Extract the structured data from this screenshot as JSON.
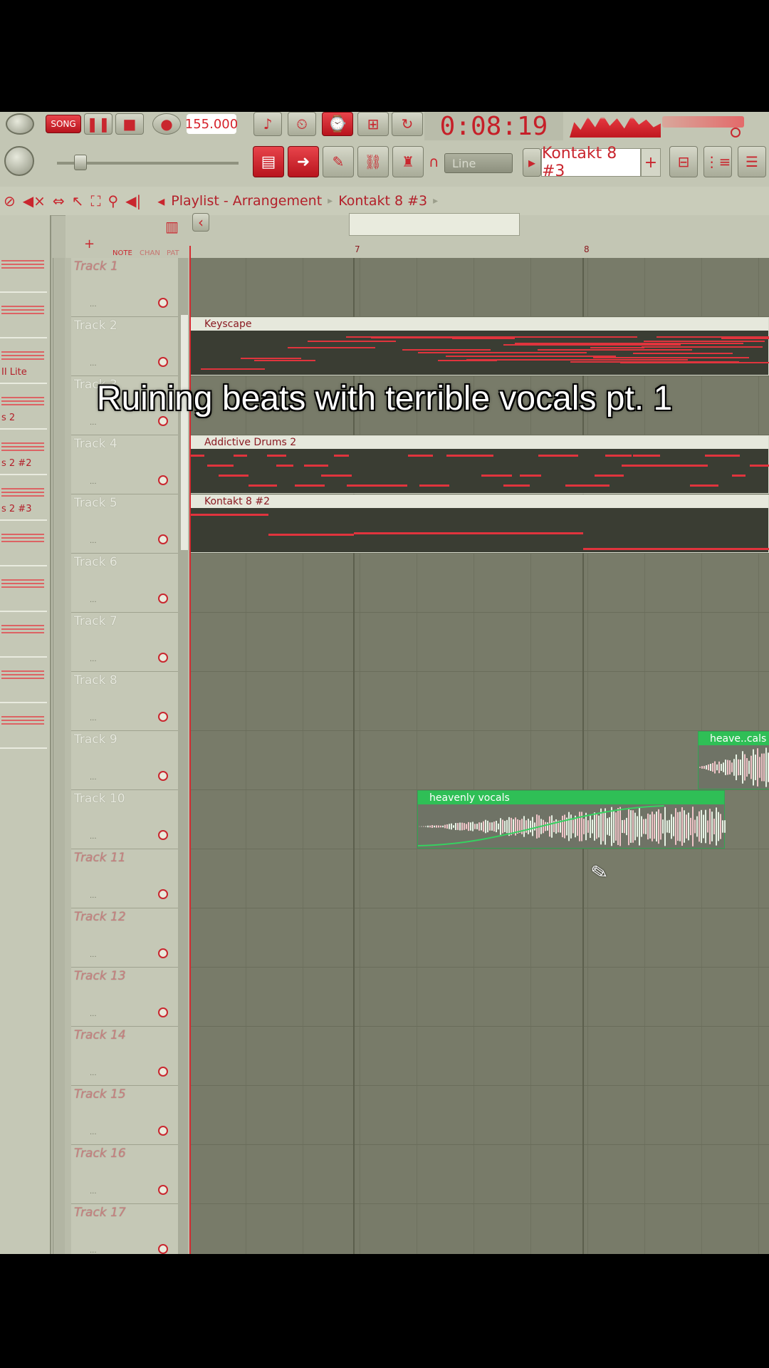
{
  "toolbar": {
    "mode_label": "SONG",
    "tempo": "155.000",
    "time": "0:08:19",
    "snap_label": "Line",
    "pattern_name": "Kontakt 8 #3",
    "pattern_add": "+"
  },
  "breadcrumb": {
    "items": [
      "Playlist - Arrangement",
      "Kontakt 8 #3"
    ]
  },
  "header_panel": {
    "add_label": "+",
    "tabs": [
      "NOTE",
      "CHAN",
      "PAT"
    ]
  },
  "ruler": {
    "bars": [
      "7",
      "8"
    ]
  },
  "picker": {
    "items": [
      "",
      "",
      "II Lite",
      "s 2",
      "s 2 #2",
      "s 2 #3",
      "",
      "",
      "",
      "",
      ""
    ]
  },
  "tracks": [
    {
      "name": "Track 1",
      "dim": true
    },
    {
      "name": "Track 2",
      "dim": false
    },
    {
      "name": "Track 3",
      "dim": false
    },
    {
      "name": "Track 4",
      "dim": false
    },
    {
      "name": "Track 5",
      "dim": false
    },
    {
      "name": "Track 6",
      "dim": false
    },
    {
      "name": "Track 7",
      "dim": false
    },
    {
      "name": "Track 8",
      "dim": false
    },
    {
      "name": "Track 9",
      "dim": false
    },
    {
      "name": "Track 10",
      "dim": false
    },
    {
      "name": "Track 11",
      "dim": true
    },
    {
      "name": "Track 12",
      "dim": true
    },
    {
      "name": "Track 13",
      "dim": true
    },
    {
      "name": "Track 14",
      "dim": true
    },
    {
      "name": "Track 15",
      "dim": true
    },
    {
      "name": "Track 16",
      "dim": true
    },
    {
      "name": "Track 17",
      "dim": true
    }
  ],
  "clips": [
    {
      "name": "Keyscape",
      "track": 2
    },
    {
      "name": "Addictive Drums 2",
      "track": 4
    },
    {
      "name": "Kontakt 8 #2",
      "track": 5
    }
  ],
  "audio_clips": [
    {
      "name": "heavenly vocals",
      "track": 10
    },
    {
      "name": "heave..cals",
      "track": 9
    }
  ],
  "caption": "Ruining beats with terrible vocals pt. 1",
  "colors": {
    "accent": "#d62a30",
    "clip_green": "#2fbf56",
    "background": "#b9bcaa"
  }
}
